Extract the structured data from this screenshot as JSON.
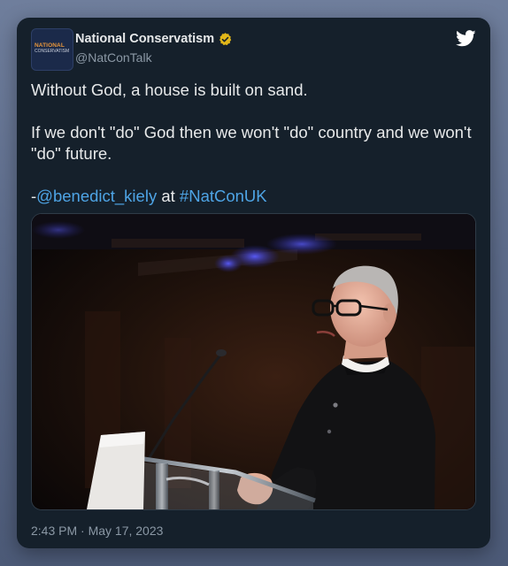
{
  "tweet": {
    "display_name": "National Conservatism",
    "handle": "@NatConTalk",
    "avatar_text": {
      "line1": "NATIONAL",
      "line2": "CONSERVATISM"
    },
    "text_line1": "Without God, a house is built on sand.",
    "text_line2": "If we don't \"do\" God then we won't \"do\" country and we won't \"do\" future.",
    "text_line3": {
      "prefix": "-",
      "mention": "@benedict_kiely",
      "middle": " at ",
      "hashtag": "#NatConUK"
    },
    "timestamp": "2:43 PM · May 17, 2023"
  },
  "icons": {
    "verified": "verified-badge-gold",
    "logo": "twitter-bird"
  },
  "colors": {
    "card_background": "#15202b",
    "text_primary": "#e7e9ea",
    "text_secondary": "#8b98a5",
    "link": "#4ea4e5",
    "verified_gold": "#e2b719"
  }
}
